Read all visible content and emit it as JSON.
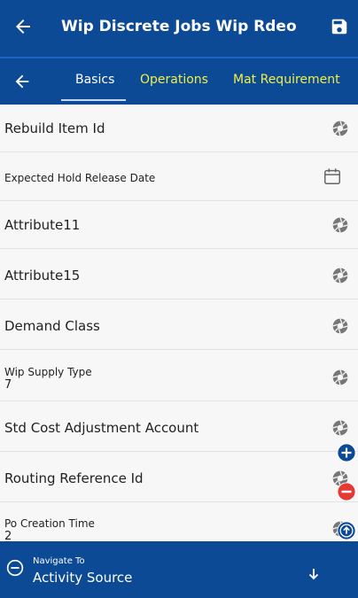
{
  "header": {
    "title": "Wip Discrete Jobs Wip Rdeo"
  },
  "tabs": [
    {
      "label": "Basics"
    },
    {
      "label": "Operations"
    },
    {
      "label": "Mat Requirement"
    }
  ],
  "fields": [
    {
      "label": "Rebuild Item Id",
      "value": ""
    },
    {
      "label": "Expected Hold Release Date",
      "value": ""
    },
    {
      "label": "Attribute11",
      "value": ""
    },
    {
      "label": "Attribute15",
      "value": ""
    },
    {
      "label": "Demand Class",
      "value": ""
    },
    {
      "label": "Wip Supply Type",
      "value": "7"
    },
    {
      "label": "Std Cost Adjustment Account",
      "value": ""
    },
    {
      "label": "Routing Reference Id",
      "value": ""
    },
    {
      "label": "Po Creation Time",
      "value": "2"
    }
  ],
  "navigate": {
    "label": "Navigate To",
    "value": "Activity Source"
  },
  "icons": {
    "back": "arrow-left-icon",
    "save": "save-icon",
    "camera": "camera-icon",
    "calendar": "calendar-icon",
    "add": "plus-circle-icon",
    "remove": "minus-circle-icon",
    "scroll_up": "arrow-up-circle-icon",
    "collapse": "minus-circle-icon",
    "expand": "arrow-down-icon"
  },
  "colors": {
    "primary": "#0d4a96",
    "tab_inactive": "#eef04a",
    "danger": "#e53935",
    "background": "#f7f7f7"
  }
}
